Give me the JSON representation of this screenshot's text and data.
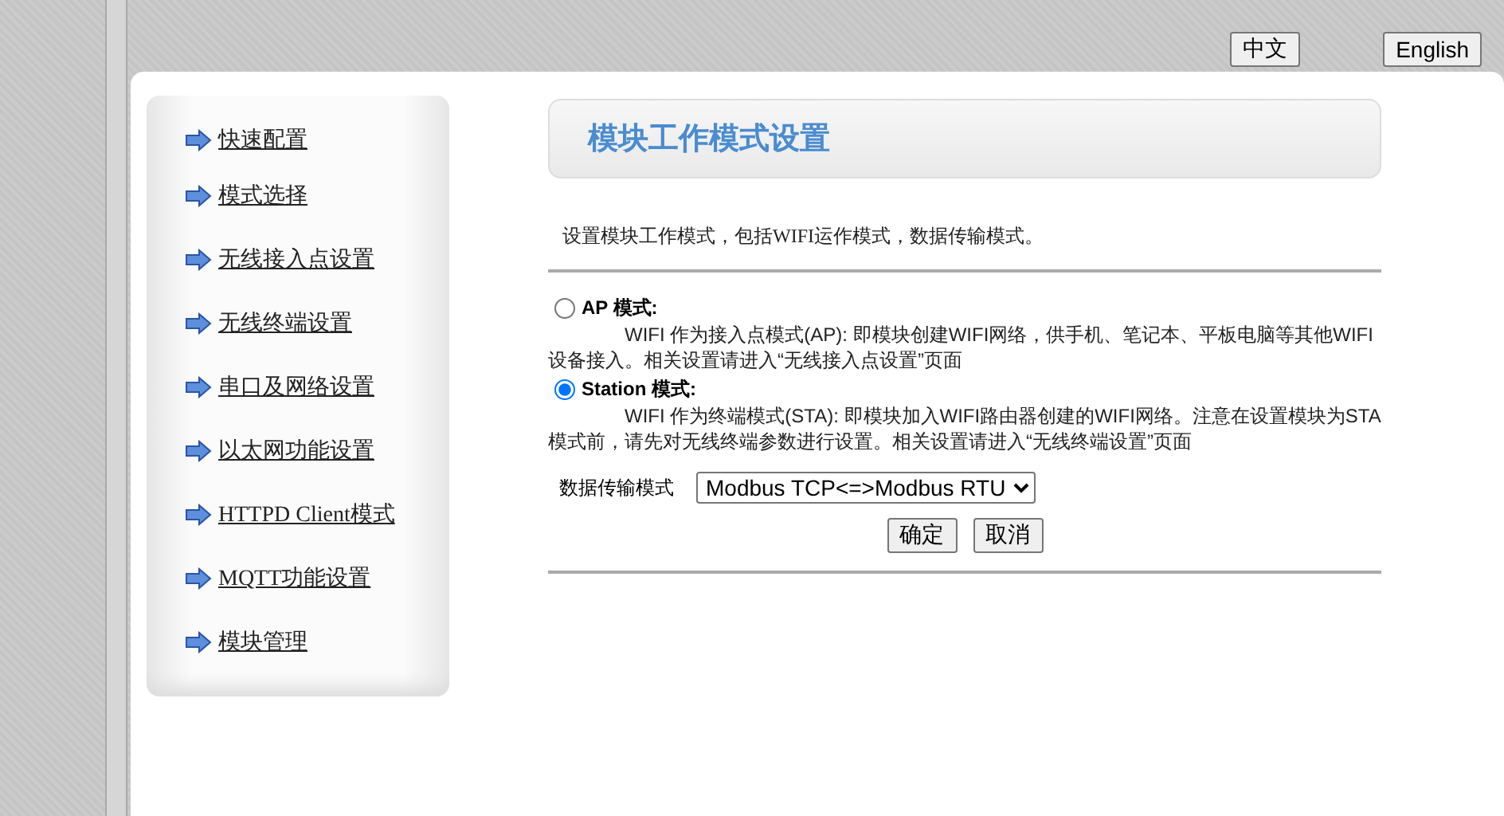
{
  "language_buttons": [
    "中文",
    "English"
  ],
  "sidebar": {
    "items": [
      {
        "label": "快速配置"
      },
      {
        "label": "模式选择"
      },
      {
        "label": "无线接入点设置"
      },
      {
        "label": "无线终端设置"
      },
      {
        "label": "串口及网络设置"
      },
      {
        "label": "以太网功能设置"
      },
      {
        "label": "HTTPD Client模式"
      },
      {
        "label": "MQTT功能设置"
      },
      {
        "label": "模块管理"
      }
    ]
  },
  "page_title": "模块工作模式设置",
  "intro": "设置模块工作模式，包括WIFI运作模式，数据传输模式。",
  "modes": [
    {
      "label": "AP 模式:",
      "selected": false,
      "description": "WIFI 作为接入点模式(AP): 即模块创建WIFI网络，供手机、笔记本、平板电脑等其他WIFI设备接入。相关设置请进入“无线接入点设置”页面"
    },
    {
      "label": "Station 模式:",
      "selected": true,
      "description": "WIFI 作为终端模式(STA): 即模块加入WIFI路由器创建的WIFI网络。注意在设置模块为STA模式前，请先对无线终端参数进行设置。相关设置请进入“无线终端设置”页面"
    }
  ],
  "transfer_mode": {
    "label": "数据传输模式",
    "value": "Modbus TCP<=>Modbus RTU"
  },
  "buttons": [
    "确定",
    "取消"
  ]
}
